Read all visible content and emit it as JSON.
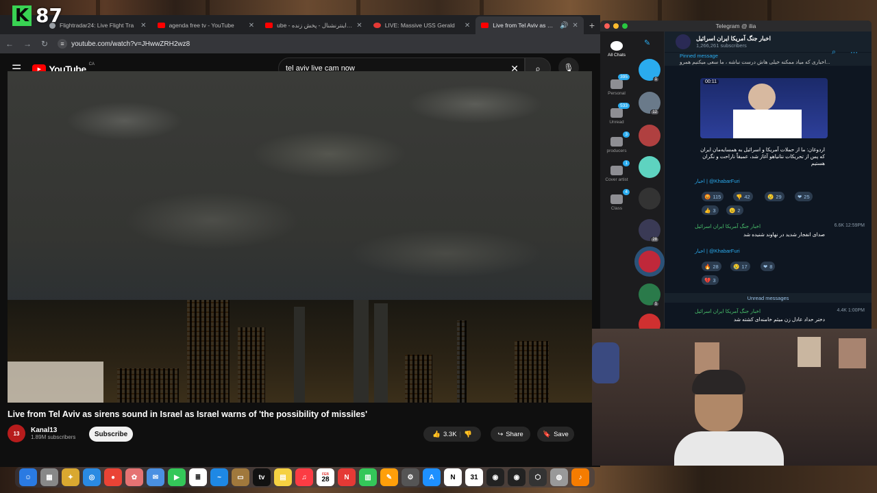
{
  "overlay": {
    "badge_letter": "K",
    "badge_number": "87"
  },
  "browser": {
    "tabs": [
      {
        "label": "Flightradar24: Live Flight Tra",
        "active": false
      },
      {
        "label": "agenda free tv - YouTube",
        "active": false
      },
      {
        "label": "ube - ایران اینترنشنال - پخش زنده",
        "active": false
      },
      {
        "label": "LIVE: Massive USS Gerald",
        "active": false
      },
      {
        "label": "Live from Tel Aviv as siren",
        "active": true
      }
    ],
    "new_tab": "+",
    "url": "youtube.com/watch?v=JHwwZRH2wz8"
  },
  "youtube": {
    "logo": "YouTube",
    "country": "CA",
    "search_value": "tel aviv live cam now",
    "video_title": "Live from Tel Aviv as sirens sound in Israel as Israel warns of 'the possibility of missiles'",
    "channel_name": "Kanal13",
    "channel_avatar_text": "13",
    "subscribers": "1.89M subscribers",
    "subscribe_label": "Subscribe",
    "likes": "3.3K",
    "share_label": "Share",
    "save_label": "Save"
  },
  "telegram": {
    "window_title": "Telegram @ ilia",
    "folders": [
      {
        "label": "All Chats",
        "badge": ""
      },
      {
        "label": "Personal",
        "badge": "395"
      },
      {
        "label": "Unread",
        "badge": "533"
      },
      {
        "label": "producers",
        "badge": "3"
      },
      {
        "label": "Cover artist",
        "badge": "1"
      },
      {
        "label": "Class",
        "badge": "4"
      }
    ],
    "chat_list_badges": [
      "1",
      "12",
      "",
      "",
      "",
      "28",
      "",
      "1"
    ],
    "channel_name": "اخبار جنگ آمریکا ایران اسرائیل",
    "channel_subs": "1,266,261 subscribers",
    "pinned_label": "Pinned message",
    "pinned_text": "اخباری که میاد ممکنه خیلی هاش درست نباشه ، ما سعی میکنیم همرو...",
    "video_time": "00:11",
    "msg1_text": "اردوغان: ما از حملات آمریکا و اسرائیل به همسایه‌مان ایران که پس از تحریکات نتانیاهو آغاز شد، عمیقاً ناراحت و نگران هستیم",
    "source_label": "اخبار | @KhabarFuri",
    "reactions1": [
      "115",
      "42",
      "29",
      "25",
      "3",
      "2"
    ],
    "msg2_sender": "اخبار جنگ آمریکا ایران اسرائیل",
    "msg2_text": "صدای انفجار شدید در نهاوند شنیده شد",
    "msg2_meta": "6.6K 12:59PM",
    "reactions2": [
      "28",
      "17",
      "8",
      "3"
    ],
    "unread_label": "Unread messages",
    "msg3_sender": "اخبار جنگ آمریکا ایران اسرائیل",
    "msg3_text": "دختر حداد عادل زن میثم خامنه‌ای کشته شد",
    "msg3_meta": "4.4K 1:00PM"
  },
  "dock": {
    "calendar_day": "28",
    "calendar_month": "FEB"
  },
  "colors": {
    "accent": "#2aabee",
    "youtube_red": "#ff0000",
    "green": "#39d353"
  }
}
